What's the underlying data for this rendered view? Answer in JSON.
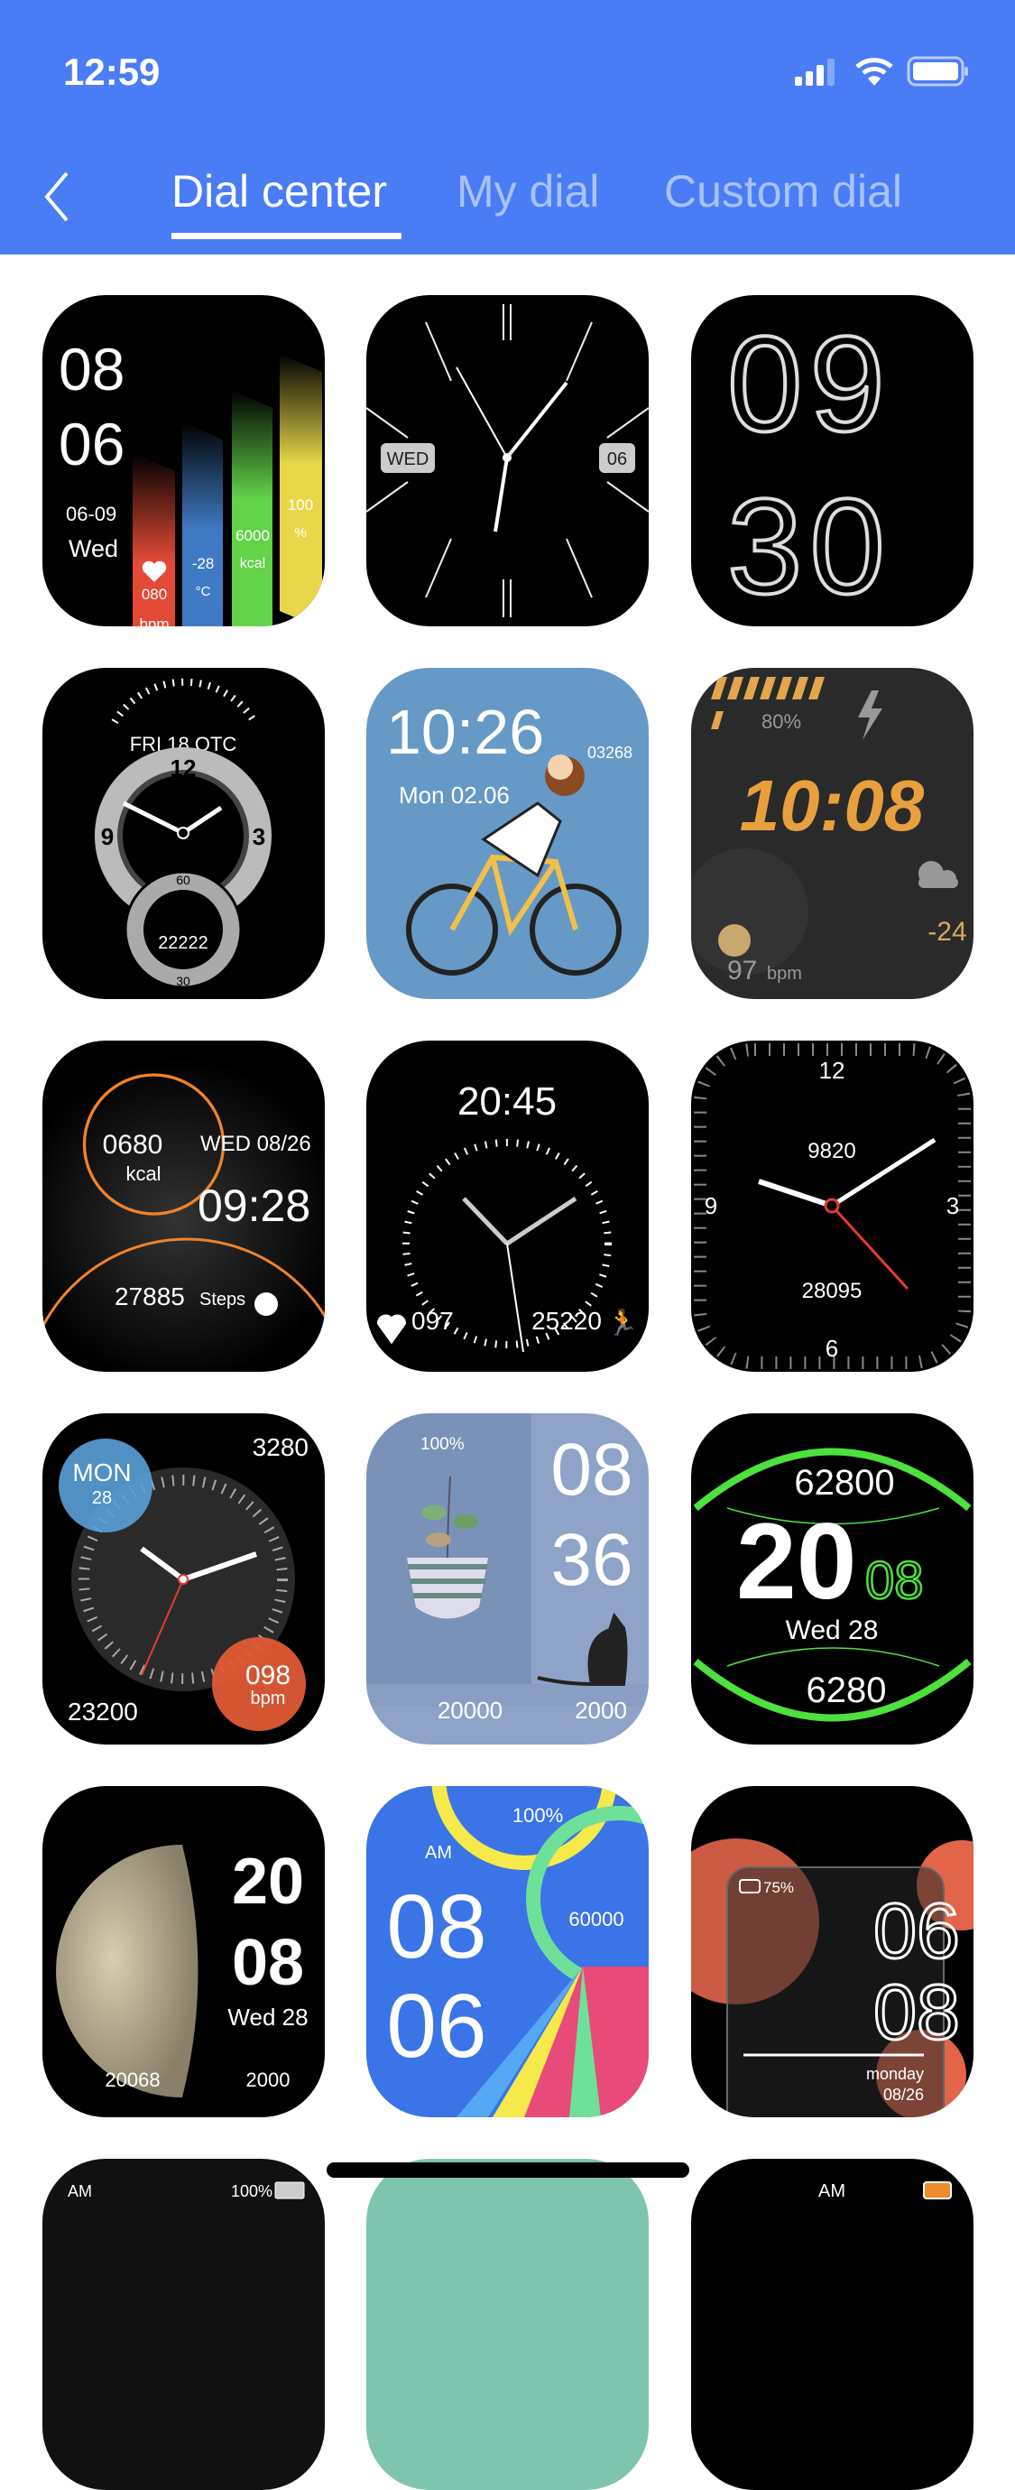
{
  "status_bar": {
    "time": "12:59",
    "icons": [
      "cellular-signal-icon",
      "wifi-icon",
      "battery-icon"
    ]
  },
  "header": {
    "back_icon": "chevron-left-icon",
    "tabs": [
      {
        "label": "Dial center",
        "active": true
      },
      {
        "label": "My dial",
        "active": false
      },
      {
        "label": "Custom dial",
        "active": false
      }
    ]
  },
  "colors": {
    "header": "#4a7cf6",
    "tab_inactive": "#a9c1fb"
  },
  "dials": [
    {
      "hour": "08",
      "minute": "06",
      "date": "06-09",
      "day": "Wed",
      "hr": "080",
      "hr_unit": "bpm",
      "temp": "-28",
      "temp_unit": "°C",
      "kcal": "6000",
      "kcal_unit": "kcal",
      "battery": "100",
      "battery_unit": "%"
    },
    {
      "day": "WED",
      "date": "06"
    },
    {
      "hour": "09",
      "minute": "30"
    },
    {
      "date": "FRI  18  OTC",
      "n12": "12",
      "n3": "3",
      "n9": "9",
      "steps": "22222",
      "sub60": "60",
      "sub30": "30"
    },
    {
      "time": "10:26",
      "steps": "03268",
      "date": "Mon 02.06"
    },
    {
      "battery": "80%",
      "time": "10:08",
      "hr": "97",
      "hr_unit": "bpm",
      "temp": "-24"
    },
    {
      "kcal": "0680",
      "kcal_unit": "kcal",
      "date": "WED 08/26",
      "time": "09:28",
      "steps": "27885",
      "steps_unit": "Steps"
    },
    {
      "time": "20:45",
      "hr": "097",
      "steps": "25220"
    },
    {
      "n12": "12",
      "n3": "3",
      "n6": "6",
      "n9": "9",
      "kcal": "9820",
      "steps": "28095"
    },
    {
      "day": "MON",
      "date": "28",
      "kcal": "3280",
      "steps": "23200",
      "hr": "098",
      "hr_unit": "bpm"
    },
    {
      "battery": "100%",
      "hour": "08",
      "minute": "36",
      "steps": "20000",
      "kcal": "2000"
    },
    {
      "steps": "62800",
      "hour": "20",
      "minute": "08",
      "date": "Wed  28",
      "kcal": "6280"
    },
    {
      "hour": "20",
      "minute": "08",
      "date": "Wed  28",
      "steps": "20068",
      "kcal": "2000"
    },
    {
      "battery": "100%",
      "ampm": "AM",
      "hour": "08",
      "minute": "06",
      "steps": "60000"
    },
    {
      "battery": "75%",
      "hour": "06",
      "minute": "08",
      "day": "monday",
      "date": "08/26"
    },
    {
      "ampm": "AM",
      "battery": "100%"
    },
    {},
    {
      "ampm": "AM"
    }
  ]
}
